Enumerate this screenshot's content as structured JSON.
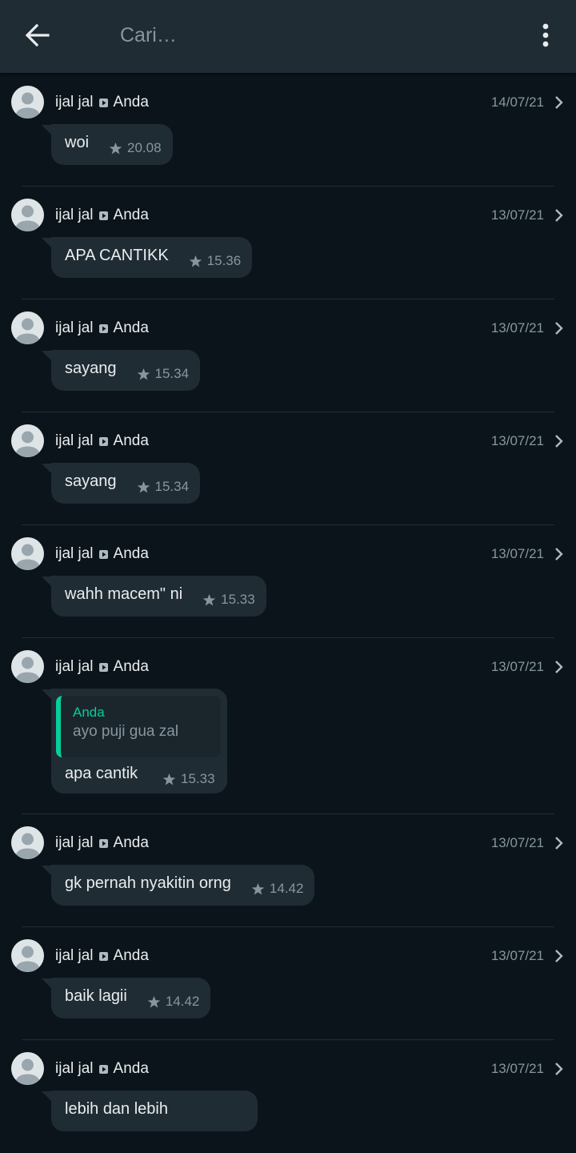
{
  "header": {
    "search_placeholder": "Cari…",
    "back_icon": "arrow-left-icon",
    "menu_icon": "more-vertical-icon"
  },
  "colors": {
    "background": "#0b141a",
    "header_bg": "#1f2c34",
    "bubble_bg": "#202c33",
    "quote_accent": "#06cf9c",
    "muted_text": "#8696a0"
  },
  "messages": [
    {
      "sender": "ijal jal",
      "recipient": "Anda",
      "date": "14/07/21",
      "text": "woi",
      "time": "20.08"
    },
    {
      "sender": "ijal jal",
      "recipient": "Anda",
      "date": "13/07/21",
      "text": "APA CANTIKK",
      "time": "15.36"
    },
    {
      "sender": "ijal jal",
      "recipient": "Anda",
      "date": "13/07/21",
      "text": "sayang",
      "time": "15.34"
    },
    {
      "sender": "ijal jal",
      "recipient": "Anda",
      "date": "13/07/21",
      "text": "sayang",
      "time": "15.34"
    },
    {
      "sender": "ijal jal",
      "recipient": "Anda",
      "date": "13/07/21",
      "text": "wahh macem\" ni",
      "time": "15.33"
    },
    {
      "sender": "ijal jal",
      "recipient": "Anda",
      "date": "13/07/21",
      "text": "apa cantik",
      "time": "15.33",
      "quote": {
        "author": "Anda",
        "text": "ayo puji gua zal"
      }
    },
    {
      "sender": "ijal jal",
      "recipient": "Anda",
      "date": "13/07/21",
      "text": "gk pernah nyakitin orng",
      "time": "14.42"
    },
    {
      "sender": "ijal jal",
      "recipient": "Anda",
      "date": "13/07/21",
      "text": "baik lagii",
      "time": "14.42"
    },
    {
      "sender": "ijal jal",
      "recipient": "Anda",
      "date": "13/07/21",
      "text": "lebih dan lebih",
      "time": ""
    }
  ]
}
